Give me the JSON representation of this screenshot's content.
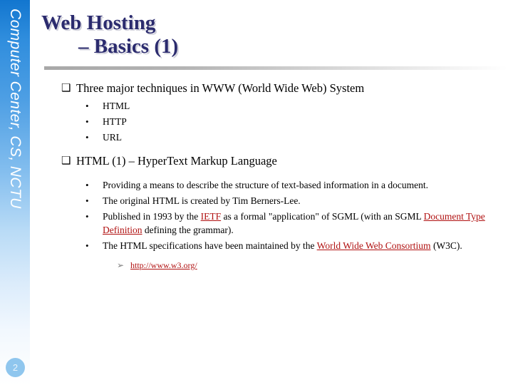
{
  "sidebar": {
    "vertical_label": "Computer Center, CS, NCTU",
    "page_number": "2",
    "gradient_top_color": "#1276cf",
    "badge_color": "#8fc6ee"
  },
  "title": {
    "line1": "Web Hosting",
    "line2": "– Basics (1)",
    "color": "#2b2b6e"
  },
  "content": {
    "bullet_marker_level1": "❑",
    "bullet_marker_level2": "•",
    "bullet_marker_level3": "➢",
    "link_color": "#b01010",
    "sections": [
      {
        "heading": "Three major techniques in WWW (World Wide Web) System",
        "items": [
          "HTML",
          "HTTP",
          "URL"
        ]
      },
      {
        "heading": "HTML (1) – HyperText Markup Language",
        "items": [
          "Providing a means to describe the structure of text-based information in a document.",
          "The original HTML is created by Tim Berners-Lee.",
          "Published in 1993 by the IETF as a formal \"application\" of SGML (with an SGML Document Type Definition defining the grammar).",
          "The HTML specifications have been maintained by the World Wide Web Consortium (W3C)."
        ],
        "item3_parts": {
          "before_link": "Published in 1993 by the ",
          "link1": "IETF",
          "middle": " as a formal \"application\" of SGML (with an SGML ",
          "link2": "Document Type Definition",
          "after_link": " defining the grammar)."
        },
        "item4_parts": {
          "before_link": "The HTML specifications have been maintained by the ",
          "link1": "World Wide Web Consortium",
          "after_link": " (W3C)."
        },
        "url": "http://www.w3.org/"
      }
    ]
  }
}
